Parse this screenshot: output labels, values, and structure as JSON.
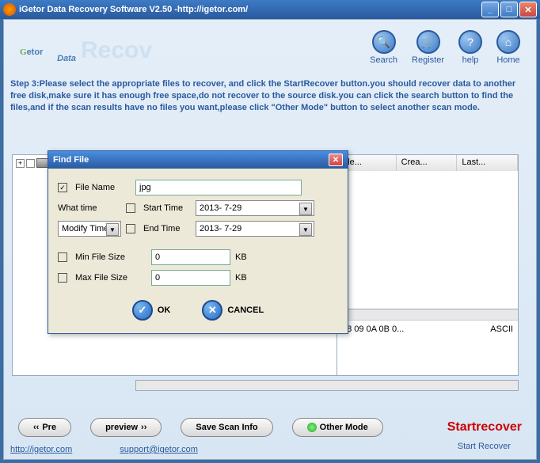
{
  "window": {
    "title": "iGetor Data Recovery Software V2.50 -http://igetor.com/"
  },
  "logo": {
    "g": "G",
    "etor": "etor",
    "data": "Data",
    "rec": "Recov"
  },
  "toolbar": {
    "search": "Search",
    "register": "Register",
    "help": "help",
    "home": "Home"
  },
  "instructions": "Step 3:Please select the appropriate files to recover, and click the StartRecover button.you should recover data to another free disk,make sure it has enough free space,do not recover to the source disk.you can click the search button to find the files,and if the scan results have no files you want,please click \"Other Mode\" button to select another scan mode.",
  "columns": {
    "file": "File...",
    "crea": "Crea...",
    "last": "Last..."
  },
  "hex": {
    "bytes": "08 09 0A 0B 0...",
    "ascii": "ASCII"
  },
  "buttons": {
    "pre": "Pre",
    "pre_arrows": "‹‹",
    "preview": "preview",
    "preview_arrows": "››",
    "save": "Save Scan Info",
    "other": "Other Mode",
    "start": "Startrecover",
    "start_sub": "Start Recover"
  },
  "footer": {
    "site": "http://igetor.com",
    "email": "support@igetor.com"
  },
  "dialog": {
    "title": "Find File",
    "filename_label": "File Name",
    "filename_value": "jpg",
    "whattime_label": "What time",
    "whattime_value": "Modify Time",
    "starttime_label": "Start Time",
    "starttime_value": "2013- 7-29",
    "endtime_label": "End Time",
    "endtime_value": "2013- 7-29",
    "minsize_label": "Min File Size",
    "minsize_value": "0",
    "maxsize_label": "Max File Size",
    "maxsize_value": "0",
    "kb": "KB",
    "ok": "OK",
    "cancel": "CANCEL"
  }
}
